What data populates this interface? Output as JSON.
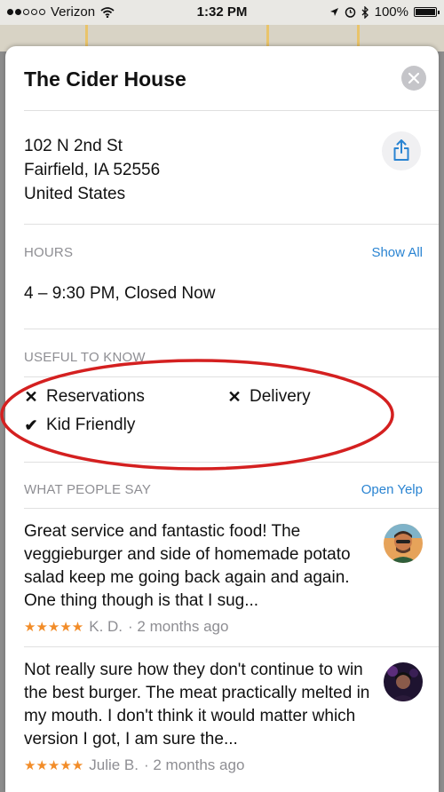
{
  "status": {
    "carrier": "Verizon",
    "time": "1:32 PM",
    "battery": "100%",
    "battery_level": 1.0
  },
  "place": {
    "name": "The Cider House"
  },
  "address": {
    "line1": "102 N 2nd St",
    "line2": "Fairfield, IA  52556",
    "line3": "United States"
  },
  "hours": {
    "heading": "HOURS",
    "show_all": "Show All",
    "value": "4 – 9:30 PM, Closed Now"
  },
  "useful": {
    "heading": "USEFUL TO KNOW",
    "items": [
      {
        "label": "Reservations",
        "glyph": "✕",
        "icon": "x-icon"
      },
      {
        "label": "Delivery",
        "glyph": "✕",
        "icon": "x-icon"
      },
      {
        "label": "Kid Friendly",
        "glyph": "✔",
        "icon": "check-icon"
      }
    ]
  },
  "reviews": {
    "heading": "WHAT PEOPLE SAY",
    "open_link": "Open Yelp",
    "items": [
      {
        "text": "Great service and fantastic food! The veggieburger and side of homemade potato salad keep me going back again and again. One thing though is that I sug...",
        "stars": "★★★★★",
        "author": "K. D.",
        "when": "· 2 months ago"
      },
      {
        "text": "Not really sure how they don't continue to win the best burger. The meat practically melted in my mouth. I don't think it would matter which version I got, I am sure the...",
        "stars": "★★★★★",
        "author": "Julie B.",
        "when": "· 2 months ago"
      }
    ]
  },
  "colors": {
    "accent": "#2a84d2",
    "stars": "#f28c28",
    "annotation": "#d42020"
  }
}
